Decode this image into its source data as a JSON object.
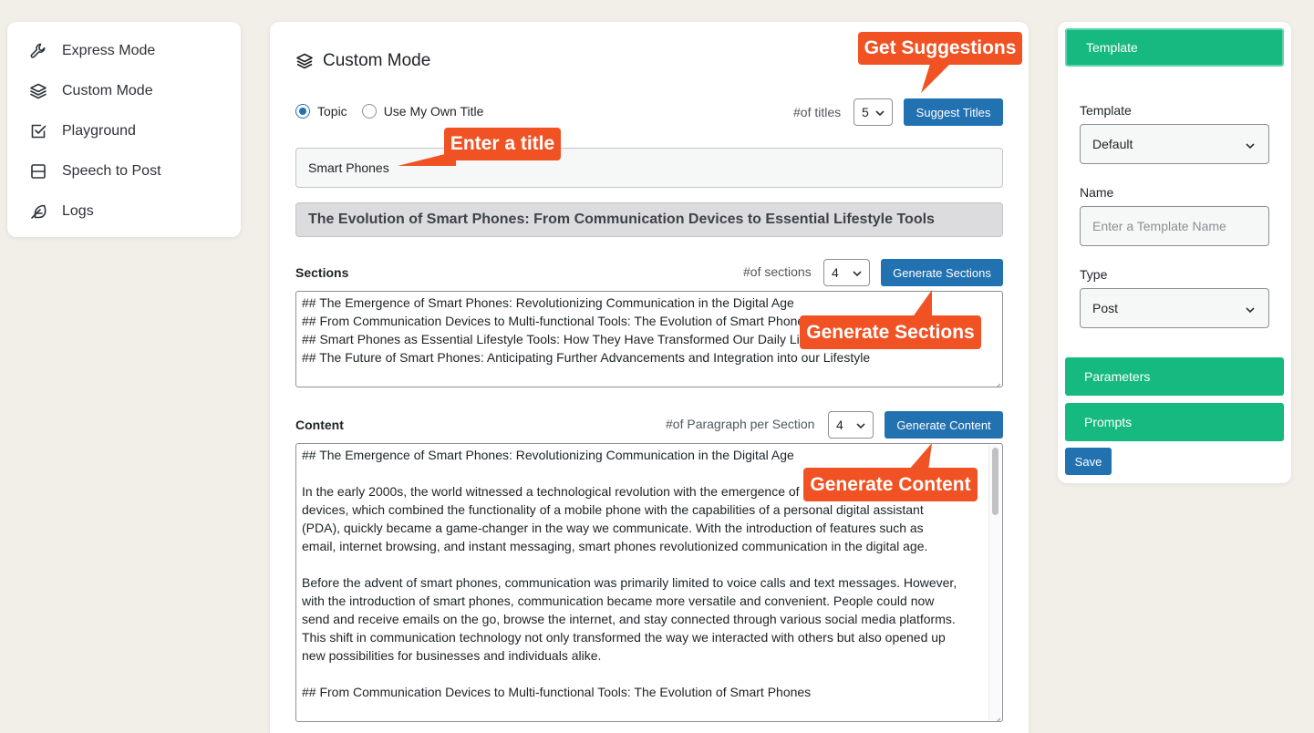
{
  "nav": {
    "items": [
      {
        "label": "Express Mode",
        "icon": "wrench-icon"
      },
      {
        "label": "Custom Mode",
        "icon": "layers-icon"
      },
      {
        "label": "Playground",
        "icon": "checkbox-icon"
      },
      {
        "label": "Speech to Post",
        "icon": "layout-icon"
      },
      {
        "label": "Logs",
        "icon": "feather-icon"
      }
    ]
  },
  "main": {
    "title": "Custom Mode",
    "radio_topic": "Topic",
    "radio_own_title": "Use My Own Title",
    "titles_count_label": "#of titles",
    "titles_count": "5",
    "suggest_titles_button": "Suggest Titles",
    "topic_value": "Smart Phones",
    "generated_title": "The Evolution of Smart Phones: From Communication Devices to Essential Lifestyle Tools",
    "sections_label": "Sections",
    "sections_count_label": "#of sections",
    "sections_count": "4",
    "generate_sections_button": "Generate Sections",
    "sections_lines": [
      "## The Emergence of Smart Phones: Revolutionizing Communication in the Digital Age",
      "## From Communication Devices to Multi-functional Tools: The Evolution of Smart Phones",
      "## Smart Phones as Essential Lifestyle Tools: How They Have Transformed Our Daily Lives",
      "## The Future of Smart Phones: Anticipating Further Advancements and Integration into our Lifestyle"
    ],
    "content_label": "Content",
    "paragraph_count_label": "#of Paragraph per Section",
    "paragraph_count": "4",
    "generate_content_button": "Generate Content",
    "content_lines": [
      "## The Emergence of Smart Phones: Revolutionizing Communication in the Digital Age",
      "",
      "In the early 2000s, the world witnessed a technological revolution with the emergence of smart phones. These",
      "devices, which combined the functionality of a mobile phone with the capabilities of a personal digital assistant",
      "(PDA), quickly became a game-changer in the way we communicate. With the introduction of features such as",
      "email, internet browsing, and instant messaging, smart phones revolutionized communication in the digital age.",
      "",
      "Before the advent of smart phones, communication was primarily limited to voice calls and text messages. However,",
      "with the introduction of smart phones, communication became more versatile and convenient. People could now",
      "send and receive emails on the go, browse the internet, and stay connected through various social media platforms.",
      "This shift in communication technology not only transformed the way we interacted with others but also opened up",
      "new possibilities for businesses and individuals alike.",
      "",
      "## From Communication Devices to Multi-functional Tools: The Evolution of Smart Phones"
    ]
  },
  "callouts": {
    "get_suggestions": "Get Suggestions",
    "enter_title": "Enter a title",
    "generate_sections": "Generate Sections",
    "generate_content": "Generate Content"
  },
  "right": {
    "template_tab": "Template",
    "template_label": "Template",
    "template_value": "Default",
    "name_label": "Name",
    "name_placeholder": "Enter a Template Name",
    "type_label": "Type",
    "type_value": "Post",
    "parameters_tab": "Parameters",
    "prompts_tab": "Prompts",
    "save_button": "Save"
  },
  "colors": {
    "accent_blue": "#2271b1",
    "green": "#16b980",
    "callout": "#f05223",
    "background": "#f1efe8"
  }
}
